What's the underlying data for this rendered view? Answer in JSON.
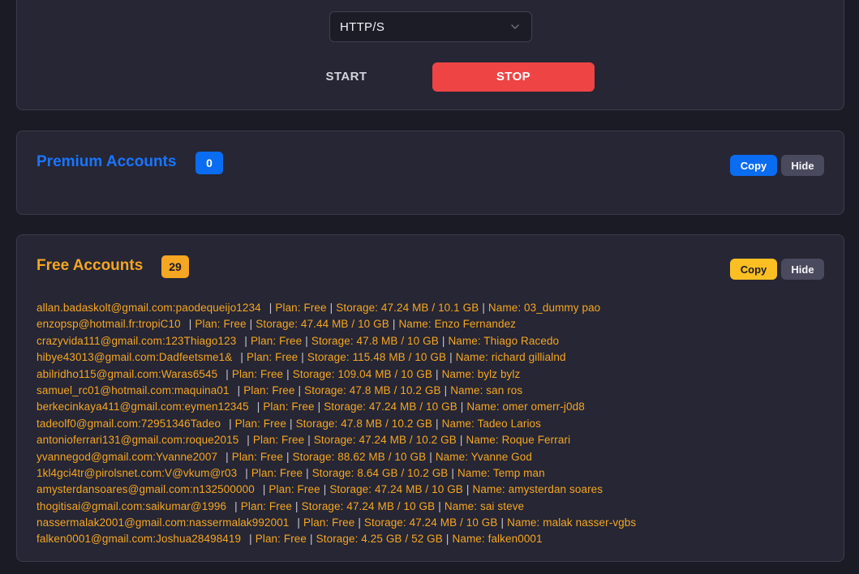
{
  "controls": {
    "protocol_select": {
      "selected": "HTTP/S"
    },
    "start_label": "START",
    "stop_label": "STOP",
    "colors": {
      "stop": "#ef4444"
    }
  },
  "premium": {
    "title": "Premium Accounts",
    "count": "0",
    "copy_label": "Copy",
    "hide_label": "Hide",
    "accent": "#0a6cf0"
  },
  "free": {
    "title": "Free Accounts",
    "count": "29",
    "copy_label": "Copy",
    "hide_label": "Hide",
    "accent": "#f5a623",
    "accounts": [
      {
        "cred": "allan.badaskolt@gmail.com:paodequeijo1234",
        "plan": "Plan: Free",
        "storage": "Storage: 47.24 MB / 10.1 GB",
        "name": "Name: 03_dummy pao"
      },
      {
        "cred": "enzopsp@hotmail.fr:tropiC10",
        "plan": "Plan: Free",
        "storage": "Storage: 47.44 MB / 10 GB",
        "name": "Name: Enzo Fernandez"
      },
      {
        "cred": "crazyvida111@gmail.com:123Thiago123",
        "plan": "Plan: Free",
        "storage": "Storage: 47.8 MB / 10 GB",
        "name": "Name: Thiago Racedo"
      },
      {
        "cred": "hibye43013@gmail.com:Dadfeetsme1&",
        "plan": "Plan: Free",
        "storage": "Storage: 115.48 MB / 10 GB",
        "name": "Name: richard gillialnd"
      },
      {
        "cred": "abilridho115@gmail.com:Waras6545",
        "plan": "Plan: Free",
        "storage": "Storage: 109.04 MB / 10 GB",
        "name": "Name: bylz bylz"
      },
      {
        "cred": "samuel_rc01@hotmail.com:maquina01",
        "plan": "Plan: Free",
        "storage": "Storage: 47.8 MB / 10.2 GB",
        "name": "Name: san ros"
      },
      {
        "cred": "berkecinkaya411@gmail.com:eymen12345",
        "plan": "Plan: Free",
        "storage": "Storage: 47.24 MB / 10 GB",
        "name": "Name: omer omerr-j0d8"
      },
      {
        "cred": "tadeolf0@gmail.com:72951346Tadeo",
        "plan": "Plan: Free",
        "storage": "Storage: 47.8 MB / 10.2 GB",
        "name": "Name: Tadeo Larios"
      },
      {
        "cred": "antonioferrari131@gmail.com:roque2015",
        "plan": "Plan: Free",
        "storage": "Storage: 47.24 MB / 10.2 GB",
        "name": "Name: Roque Ferrari"
      },
      {
        "cred": "yvannegod@gmail.com:Yvanne2007",
        "plan": "Plan: Free",
        "storage": "Storage: 88.62 MB / 10 GB",
        "name": "Name: Yvanne God"
      },
      {
        "cred": "1kl4gci4tr@pirolsnet.com:V@vkum@r03",
        "plan": "Plan: Free",
        "storage": "Storage: 8.64 GB / 10.2 GB",
        "name": "Name: Temp man"
      },
      {
        "cred": "amysterdansoares@gmail.com:n132500000",
        "plan": "Plan: Free",
        "storage": "Storage: 47.24 MB / 10 GB",
        "name": "Name: amysterdan  soares"
      },
      {
        "cred": "thogitisai@gmail.com:saikumar@1996",
        "plan": "Plan: Free",
        "storage": "Storage: 47.24 MB / 10 GB",
        "name": "Name: sai steve"
      },
      {
        "cred": "nassermalak2001@gmail.com:nassermalak992001",
        "plan": "Plan: Free",
        "storage": "Storage: 47.24 MB / 10 GB",
        "name": "Name: malak nasser-vgbs"
      },
      {
        "cred": "falken0001@gmail.com:Joshua28498419",
        "plan": "Plan: Free",
        "storage": "Storage: 4.25 GB / 52 GB",
        "name": "Name: falken0001"
      }
    ]
  }
}
